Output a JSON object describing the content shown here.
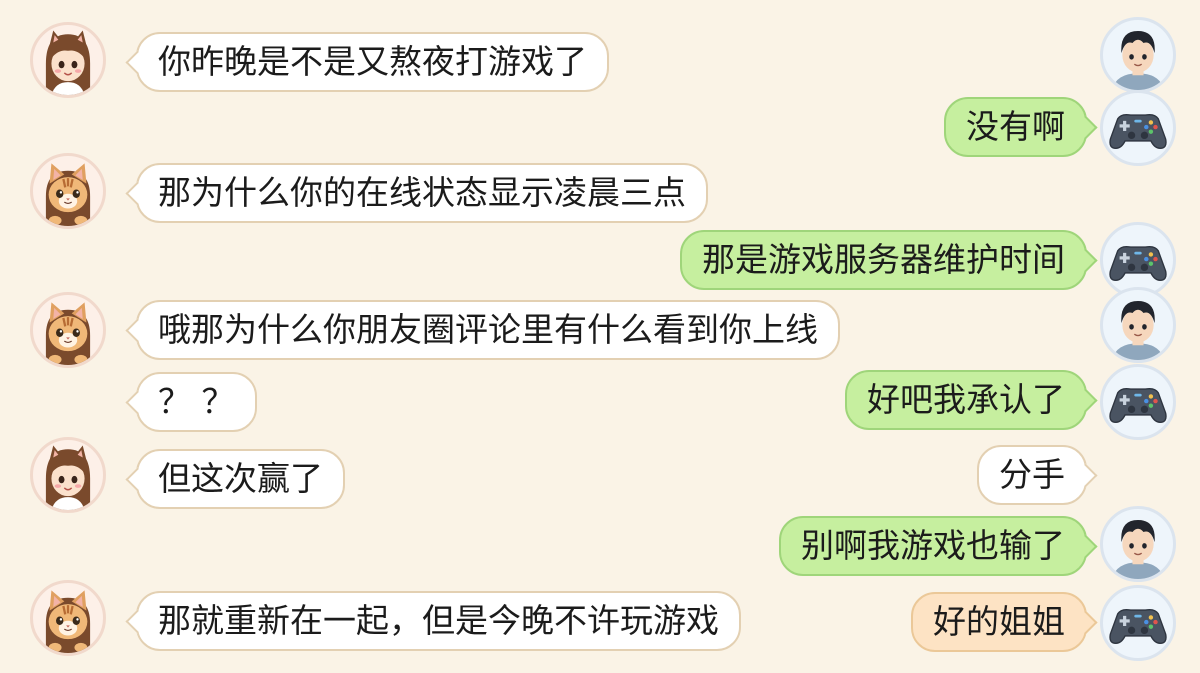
{
  "colors": {
    "background": "#faf3e6",
    "bubble_white": "#ffffff",
    "bubble_green": "#c6ef9f",
    "bubble_peach": "#fde3c4"
  },
  "avatars": {
    "girl": "girl-avatar",
    "cat": "cat-avatar",
    "boy": "boy-avatar",
    "controller": "game-controller-icon"
  },
  "messages": [
    {
      "side": "left",
      "avatar": "girl",
      "text": "你昨晚是不是又熬夜打游戏了"
    },
    {
      "side": "right",
      "avatar": "boy",
      "text": ""
    },
    {
      "side": "right",
      "avatar": "controller",
      "text": "没有啊"
    },
    {
      "side": "left",
      "avatar": "cat",
      "text": "那为什么你的在线状态显示凌晨三点"
    },
    {
      "side": "right",
      "avatar": "controller",
      "text": "那是游戏服务器维护时间"
    },
    {
      "side": "left",
      "avatar": "cat",
      "text": "哦那为什么你朋友圈评论里有什么看到你上线"
    },
    {
      "side": "right",
      "avatar": "boy",
      "text": ""
    },
    {
      "side": "left",
      "avatar": "none",
      "text": "？ ？"
    },
    {
      "side": "right",
      "avatar": "controller",
      "text": "好吧我承认了"
    },
    {
      "side": "left",
      "avatar": "girl",
      "text": "但这次赢了"
    },
    {
      "side": "right",
      "avatar": "none",
      "text": "分手"
    },
    {
      "side": "right",
      "avatar": "boy",
      "text": "别啊我游戏也输了"
    },
    {
      "side": "left",
      "avatar": "cat",
      "text": "那就重新在一起，但是今晚不许玩游戏"
    },
    {
      "side": "right",
      "avatar": "controller",
      "text": "好的姐姐"
    }
  ]
}
